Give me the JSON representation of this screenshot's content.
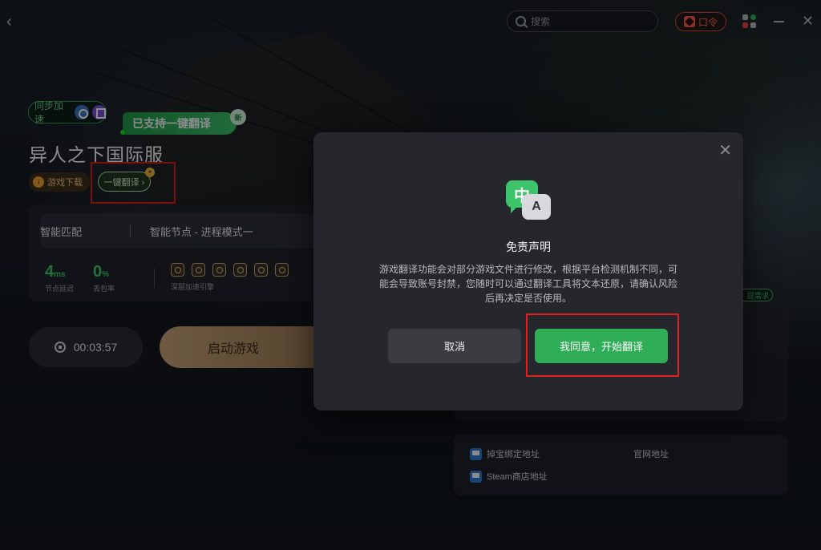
{
  "topbar": {
    "search_placeholder": "搜索",
    "kouling_label": "口令"
  },
  "game": {
    "sync_label": "同步加速",
    "support_tag": "已支持一键翻译",
    "support_tag_badge": "新",
    "title": "异人之下国际服",
    "download_label": "游戏下载",
    "translate_label": "一键翻译 ›"
  },
  "stats": {
    "mode_label": "智能匹配",
    "node_label": "智能节点 - 进程模式一",
    "ping_value": "4",
    "ping_unit": "ms",
    "ping_label": "节点延迟",
    "loss_value": "0",
    "loss_unit": "%",
    "loss_label": "丢包率",
    "engine_label": "深层加速引擎"
  },
  "actions": {
    "timer": "00:03:57",
    "launch_label": "启动游戏"
  },
  "right": {
    "req_tag": "提需求",
    "links": [
      "掉宝绑定地址",
      "官网地址",
      "Steam商店地址"
    ]
  },
  "modal": {
    "icon_zh": "中",
    "icon_en": "A",
    "title": "免责声明",
    "body": "游戏翻译功能会对部分游戏文件进行修改，根据平台检测机制不同，可能会导致账号封禁，您随时可以通过翻译工具将文本还原，请确认风险后再决定是否使用。",
    "cancel_label": "取消",
    "agree_label": "我同意，开始翻译"
  },
  "colors": {
    "accent_green": "#2fae57",
    "highlight_red": "#e0201c",
    "launch_gold": "#c9a57a"
  }
}
